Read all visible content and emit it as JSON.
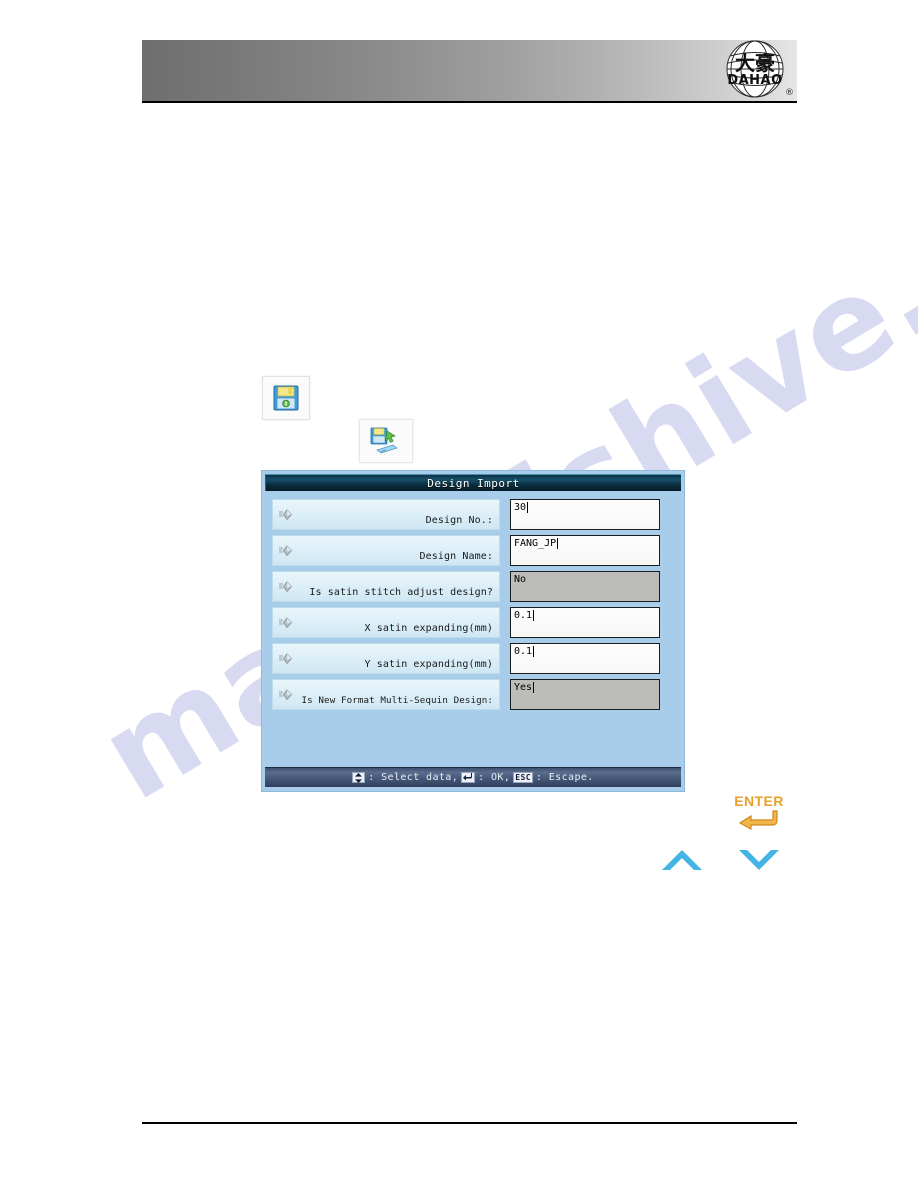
{
  "header": {
    "logo_primary_text": "大豪",
    "logo_brand_text": "DAHAO",
    "logo_trademark": "®"
  },
  "watermark": {
    "text": "manualshive.com"
  },
  "icons": {
    "save_icon_name": "floppy-disk-save-icon",
    "import_icon_name": "design-import-icon",
    "enter_key_label": "ENTER",
    "chevron_up_name": "chevron-up-icon",
    "chevron_down_name": "chevron-down-icon"
  },
  "dialog": {
    "title": "Design Import",
    "rows": [
      {
        "label": "Design No.:",
        "value": "30",
        "editable": true,
        "caret": true,
        "wide": false
      },
      {
        "label": "Design Name:",
        "value": "FANG_JP",
        "editable": true,
        "caret": true,
        "wide": false
      },
      {
        "label": "Is satin stitch adjust design?",
        "value": "No",
        "editable": false,
        "caret": false,
        "wide": false
      },
      {
        "label": "X satin expanding(mm)",
        "value": "0.1",
        "editable": true,
        "caret": true,
        "wide": false
      },
      {
        "label": "Y satin expanding(mm)",
        "value": "0.1",
        "editable": true,
        "caret": true,
        "wide": false
      },
      {
        "label": "Is New Format Multi-Sequin Design:",
        "value": "Yes",
        "editable": false,
        "caret": true,
        "wide": true
      }
    ],
    "statusbar": {
      "select_text": ": Select data,",
      "ok_text": ": OK,",
      "esc_key": "ESC",
      "escape_text": ": Escape."
    }
  },
  "colors": {
    "dialog_background": "#a8cdea",
    "titlebar_dark": "#0d3242",
    "row_label_light": "#eaf6fb",
    "readonly_value": "#bcbcb8",
    "chevron_blue": "#44b4e4",
    "enter_orange": "#e8a02a",
    "watermark_blue": "#b9bde8"
  }
}
